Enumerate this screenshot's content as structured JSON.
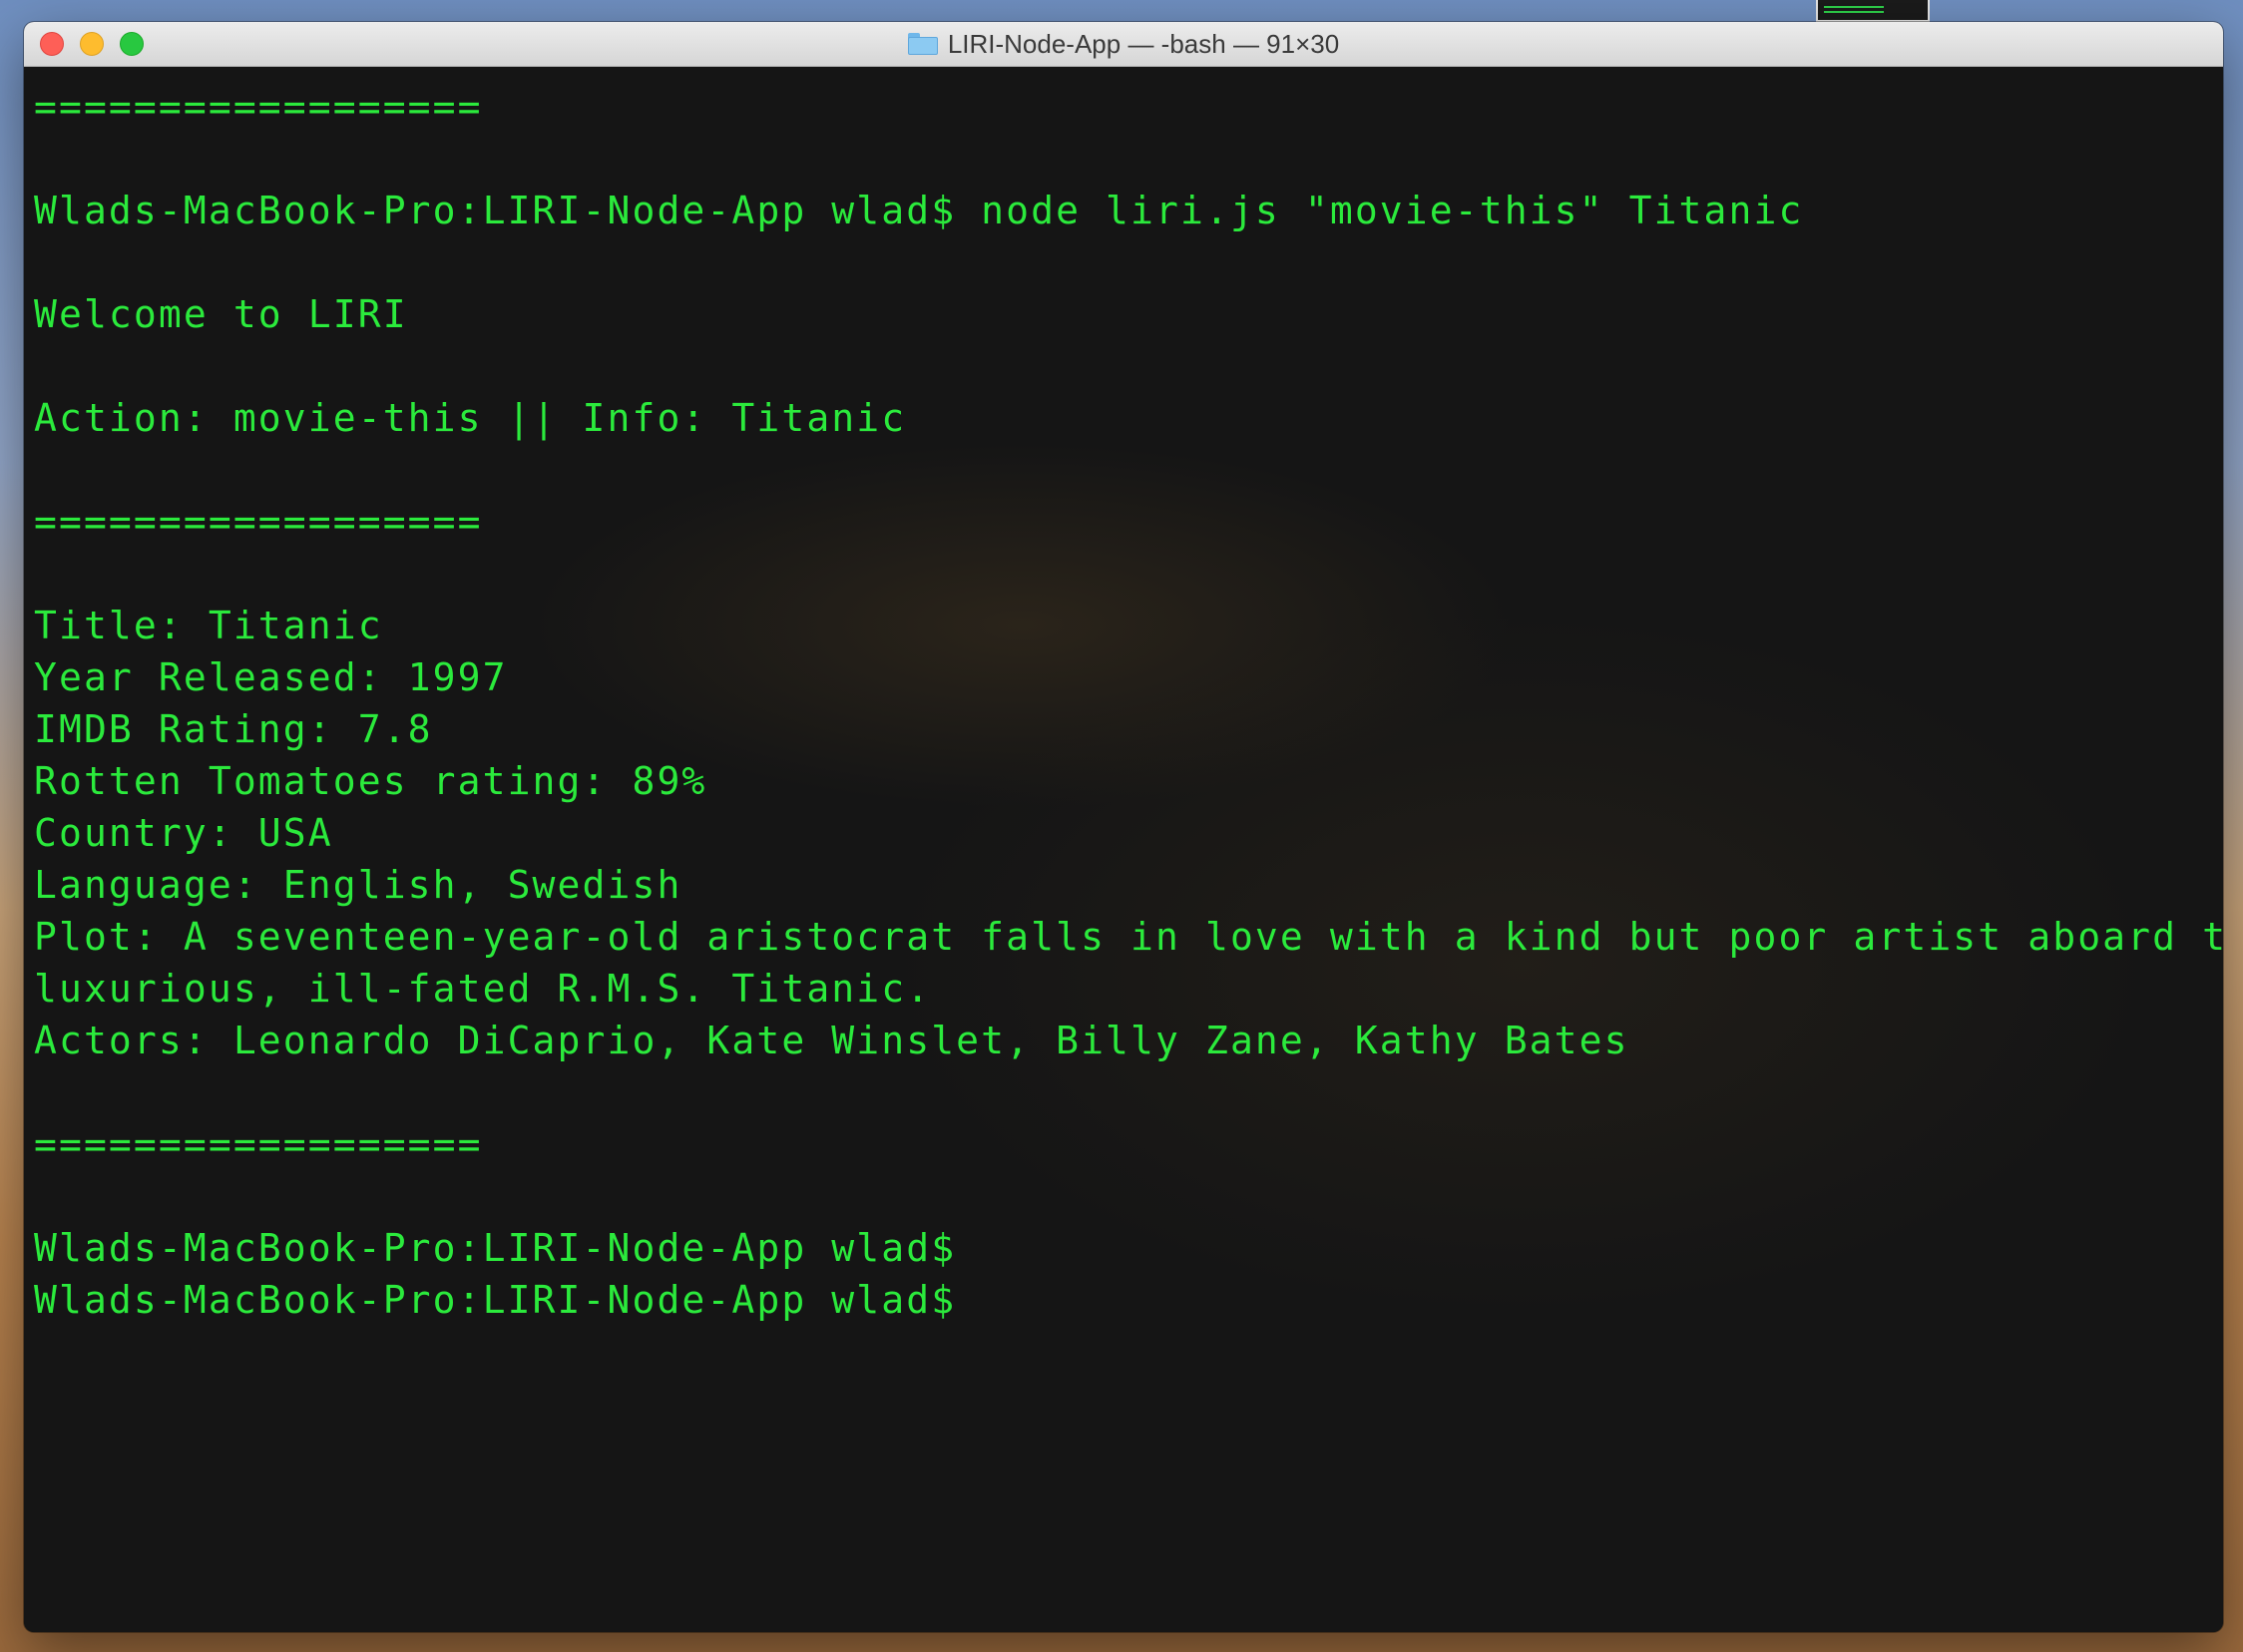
{
  "window": {
    "title": "LIRI-Node-App — -bash — 91×30"
  },
  "terminal": {
    "lines": [
      "==================",
      "",
      "Wlads-MacBook-Pro:LIRI-Node-App wlad$ node liri.js \"movie-this\" Titanic",
      "",
      "Welcome to LIRI",
      "",
      "Action: movie-this || Info: Titanic",
      "",
      "==================",
      "",
      "Title: Titanic",
      "Year Released: 1997",
      "IMDB Rating: 7.8",
      "Rotten Tomatoes rating: 89%",
      "Country: USA",
      "Language: English, Swedish",
      "Plot: A seventeen-year-old aristocrat falls in love with a kind but poor artist aboard the",
      "luxurious, ill-fated R.M.S. Titanic.",
      "Actors: Leonardo DiCaprio, Kate Winslet, Billy Zane, Kathy Bates",
      "",
      "==================",
      "",
      "Wlads-MacBook-Pro:LIRI-Node-App wlad$",
      "Wlads-MacBook-Pro:LIRI-Node-App wlad$"
    ]
  },
  "colors": {
    "text": "#2bea3c",
    "background": "#151515"
  }
}
